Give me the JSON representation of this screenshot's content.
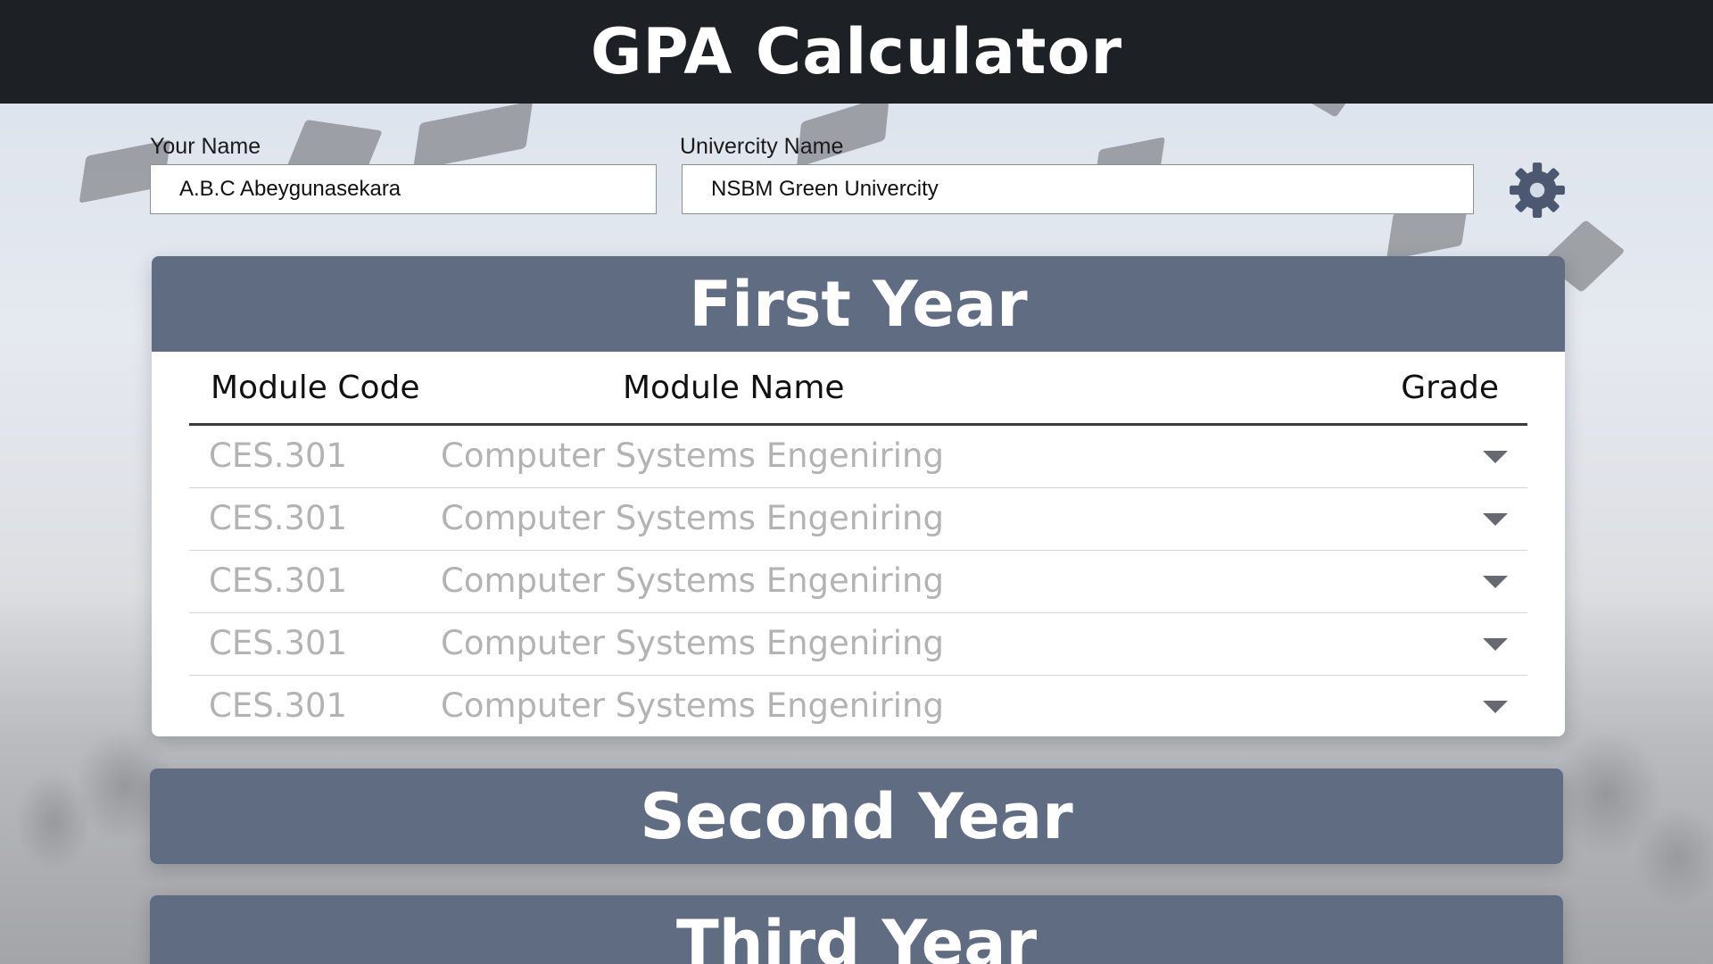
{
  "app": {
    "title": "GPA Calculator"
  },
  "form": {
    "name_label": "Your Name",
    "name_value": "A.B.C Abeygunasekara",
    "university_label": "Univercity Name",
    "university_value": "NSBM Green Univercity",
    "settings_icon": "gear-icon"
  },
  "table": {
    "headers": {
      "code": "Module Code",
      "name": "Module Name",
      "grade": "Grade"
    }
  },
  "years": [
    {
      "title": "First Year",
      "expanded": true,
      "modules": [
        {
          "code": "CES.301",
          "name": "Computer Systems Engenirin​g"
        },
        {
          "code": "CES.301",
          "name": "Computer Systems Engenirin​g"
        },
        {
          "code": "CES.301",
          "name": "Computer Systems Engenirin​g"
        },
        {
          "code": "CES.301",
          "name": "Computer Systems Engenirin​g"
        },
        {
          "code": "CES.301",
          "name": "Computer Systems Engenirin​g"
        }
      ]
    },
    {
      "title": "Second Year",
      "expanded": false
    },
    {
      "title": "Third Year",
      "expanded": false
    }
  ],
  "colors": {
    "topbar": "#1d2024",
    "card_header": "#606c82",
    "gear": "#4c5870",
    "module_text": "#b3b3b3"
  }
}
